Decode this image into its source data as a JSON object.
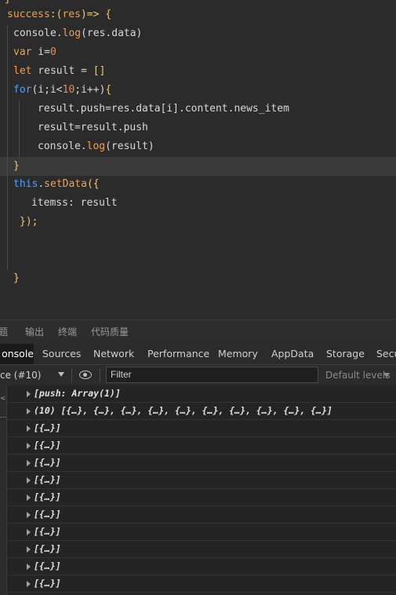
{
  "editor": {
    "top_fragment": "}",
    "lines": {
      "l1a": "success",
      "l1b": ":(",
      "l1c": "res",
      "l1d": ")=> {",
      "l2a": "console",
      "l2b": ".",
      "l2c": "log",
      "l2d": "(res.data)",
      "l3a": "var",
      "l3b": " i=",
      "l3c": "0",
      "l4a": "let",
      "l4b": " result = ",
      "l4c": "[]",
      "l5a": "for",
      "l5b": "(i;i<",
      "l5c": "10",
      "l5d": ";i++)",
      "l5e": "{",
      "l6": "result.push=res.data[i].content.news_item",
      "l7": "result=result.push",
      "l8a": "console.",
      "l8b": "log",
      "l8c": "(result)",
      "l9": "}",
      "l10a": "this",
      "l10b": ".",
      "l10c": "setData",
      "l10d": "({",
      "l11": "itemss: result",
      "l12": "});",
      "l13": "}"
    }
  },
  "panel_tabs": [
    "题",
    "输出",
    "终端",
    "代码质量"
  ],
  "devtools_tabs": {
    "console": "onsole",
    "sources": "Sources",
    "network": "Network",
    "performance": "Performance",
    "memory": "Memory",
    "appdata": "AppData",
    "storage": "Storage",
    "security": "Secu"
  },
  "toolbar": {
    "context": "ce (#10)",
    "filter_placeholder": "Filter",
    "levels": "Default levels"
  },
  "console": {
    "rows": [
      "[push: Array(1)]",
      "(10) [{…}, {…}, {…}, {…}, {…}, {…}, {…}, {…}, {…}, {…}]",
      "[{…}]",
      "[{…}]",
      "[{…}]",
      "[{…}]",
      "[{…}]",
      "[{…}]",
      "[{…}]",
      "[{…}]",
      "[{…}]",
      "[{…}]"
    ],
    "gutter_marks": [
      "<",
      "..."
    ]
  },
  "colors": {
    "editor_bg": "#2b2b2b",
    "keyword_orange": "#f0a04b",
    "keyword_blue": "#4aa3ff",
    "console_bg": "#242424"
  }
}
